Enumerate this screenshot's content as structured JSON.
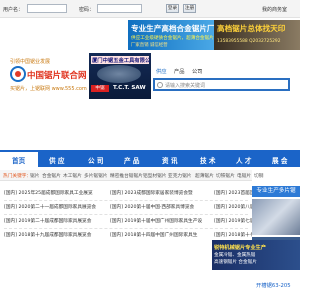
{
  "login": {
    "username_label": "用户名：",
    "password_label": "密码：",
    "login_button": "登录",
    "register_button": "注册",
    "my_business": "我的商务室"
  },
  "banners": {
    "left": {
      "title": "专业生产高档合金锯片厂家",
      "subtitle": "供应工业级硬质合金锯片，超薄合金锯片",
      "line": "厂家直销 诚信经营"
    },
    "right": {
      "title": "高档锯片总体找天印",
      "phone": "13583955588  Q2032725292"
    }
  },
  "logo": {
    "slogan": "引领中国锯业发展",
    "name": "中国锯片联合网",
    "url": "买锯片，上锯联网 www.555.com"
  },
  "saw_ad": {
    "title": "厦门中锯五金工具有限公司",
    "badge": "中锯",
    "brand": "T.C.T. SAW"
  },
  "search": {
    "tabs": [
      "供应",
      "产品",
      "公司"
    ],
    "placeholder": "请输入搜索关键词"
  },
  "nav": {
    "items": [
      "首页",
      "供 应",
      "公 司",
      "产 品",
      "资 讯",
      "技 术",
      "人 才",
      "展 会"
    ]
  },
  "keywords": {
    "label": "热门关键字：",
    "items": [
      "锯片",
      "合金锯片",
      "木工锯片",
      "多片锯锯片",
      "精密推台锯锯片",
      "铝型材锯片",
      "亚克力锯片",
      "超薄锯片",
      "切铁锯片",
      "电锯片",
      "切钢"
    ]
  },
  "news": {
    "left": [
      "[国内] 2025年25届成都国际家具工业展览",
      "[国内] 2020第二十一届成都国际家具展览会",
      "[国内] 2019第二十届成都国际家具展览会",
      "[国内] 2018第十九届成都国际家具展览会"
    ],
    "middle": [
      "[国内] 2023成都国际家居家装博览会暨",
      "[国内] 2020第十届中国·西部家具博览会",
      "[国内] 2019第十届中国广州国际家具生产设",
      "[国内] 2018第十四届中国广州国际家具生"
    ],
    "right": [
      "[国内] 2023首届国际家具",
      "[国内] 2020第八届中国·",
      "[国内] 2019第七届中国·",
      "[国内] 2018第十七届中国"
    ]
  },
  "side": {
    "head": "专业生产多片锯",
    "bottom": "开槽锯63-205"
  },
  "bottom_ad": {
    "line1": "锐特机械锯片专业生产",
    "line2": "金属冷锯、金属热锯",
    "line3": "高速钢锯片 合金锯片"
  }
}
